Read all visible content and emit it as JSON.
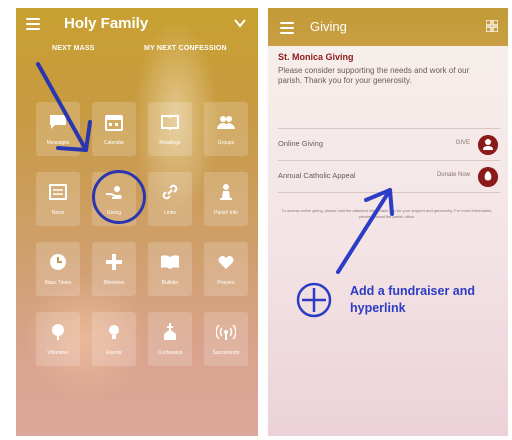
{
  "left_screen": {
    "title": "Holy Family",
    "sub_links": [
      "NEXT MASS",
      "MY NEXT CONFESSION"
    ],
    "tiles": [
      {
        "label": "Messages",
        "icon": "chat-icon"
      },
      {
        "label": "Calendar",
        "icon": "calendar-icon"
      },
      {
        "label": "Readings",
        "icon": "book-icon"
      },
      {
        "label": "Groups",
        "icon": "people-icon"
      },
      {
        "label": "News",
        "icon": "newspaper-icon"
      },
      {
        "label": "Giving",
        "icon": "giving-hand-icon"
      },
      {
        "label": "Links",
        "icon": "link-icon"
      },
      {
        "label": "Parish Info",
        "icon": "chess-icon"
      },
      {
        "label": "Mass Times",
        "icon": "clock-icon"
      },
      {
        "label": "Ministries",
        "icon": "cross-icon"
      },
      {
        "label": "Bulletin",
        "icon": "open-book-icon"
      },
      {
        "label": "Prayers",
        "icon": "heart-hands-icon"
      },
      {
        "label": "Volunteer",
        "icon": "tree-icon"
      },
      {
        "label": "Events",
        "icon": "lightbulb-icon"
      },
      {
        "label": "Confession",
        "icon": "church-icon"
      },
      {
        "label": "Sacraments",
        "icon": "signal-icon"
      }
    ]
  },
  "right_screen": {
    "title": "Giving",
    "org_title": "St. Monica Giving",
    "intro": "Please consider supporting the needs and work of our parish. Thank you for your generosity.",
    "rows": [
      {
        "label": "Online Giving",
        "action": "GIVE"
      },
      {
        "label": "Annual Catholic Appeal",
        "action": "Donate Now"
      }
    ],
    "fineprint": "To access online giving, please visit the attached link. Thank you for your support and generosity. For more information, please contact the parish office."
  },
  "annotation": {
    "text": "Add a fundraiser and hyperlink",
    "color": "#2d3cc4"
  },
  "colors": {
    "header_gold": "#c29a36",
    "maroon": "#8b1a1a",
    "annotation_blue": "#2d3cc4"
  }
}
